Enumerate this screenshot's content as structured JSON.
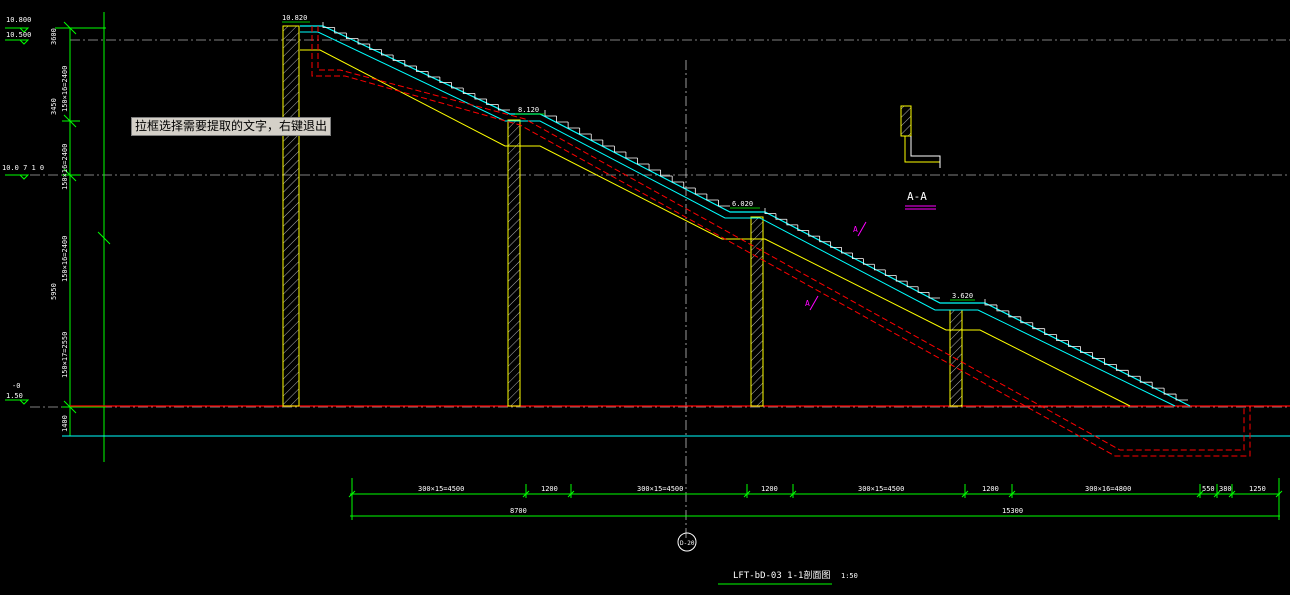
{
  "elevations": {
    "top_left": "10.800",
    "left_2": "10.500",
    "mid_left": "10.0 7 1  0",
    "low_left_a": "-0",
    "low_left_b": "1.50",
    "landing_top": "10.820",
    "landing_2": "8.120",
    "landing_3": "6.020",
    "landing_4": "3.620"
  },
  "vertical_dims": [
    "150×16=2400",
    "3600",
    "150×16=2400",
    "3450",
    "150×16=2400",
    "5950",
    "150×17=2550",
    "1400"
  ],
  "horizontal_dims_row1": [
    "300×15=4500",
    "1200",
    "300×15=4500",
    "1200",
    "300×15=4500",
    "1200",
    "300×16=4800",
    "550",
    "380",
    "1250"
  ],
  "horizontal_dims_row2": [
    "8700",
    "15300"
  ],
  "section_label": "A-A",
  "axis_bubble": "D-20",
  "drawing_title": "LFT-bD-03  1-1剖面图",
  "scale": "1:50",
  "marker": "A",
  "tooltip": "拉框选择需要提取的文字，右键退出",
  "colors": {
    "background": "#000000",
    "dim": "#00ff00",
    "cyan": "#00ffff",
    "yellow": "#ffff00",
    "red": "#ff0000",
    "white": "#ffffff",
    "magenta": "#ff00ff"
  }
}
